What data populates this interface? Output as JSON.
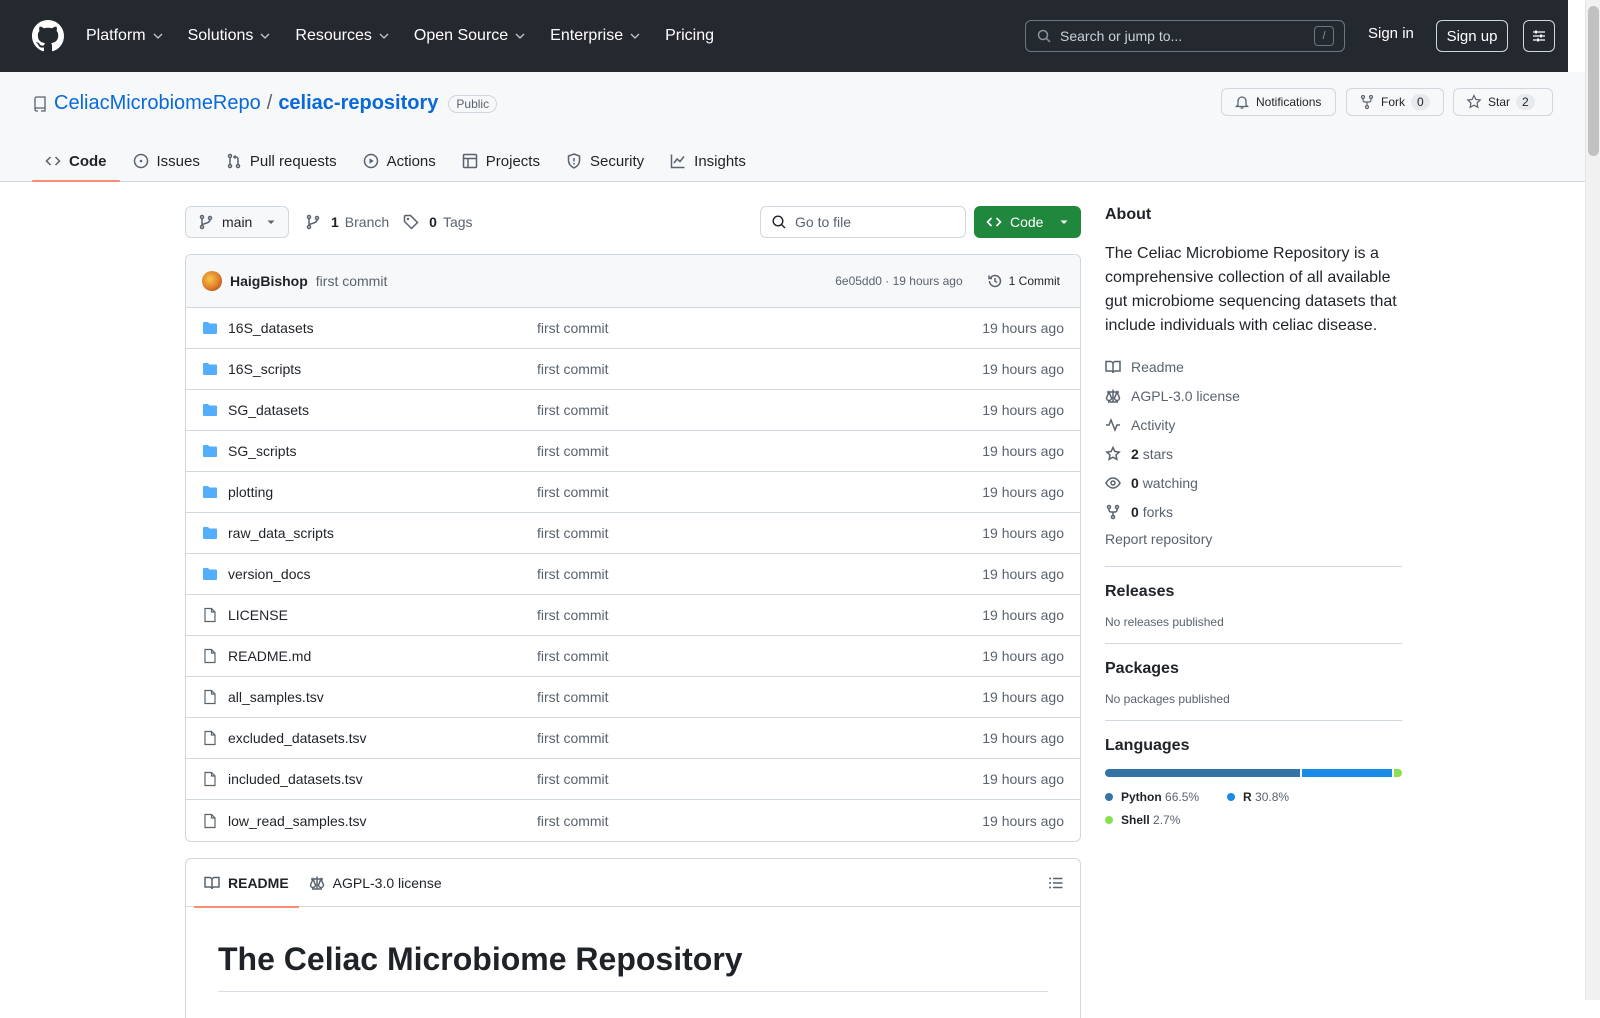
{
  "topbar": {
    "nav": [
      "Platform",
      "Solutions",
      "Resources",
      "Open Source",
      "Enterprise"
    ],
    "pricing": "Pricing",
    "search_placeholder": "Search or jump to...",
    "search_shortcut": "/",
    "sign_in": "Sign in",
    "sign_up": "Sign up"
  },
  "repo": {
    "owner": "CeliacMicrobiomeRepo",
    "separator": "/",
    "name": "celiac-repository",
    "visibility": "Public",
    "notifications": "Notifications",
    "fork_label": "Fork",
    "fork_count": "0",
    "star_label": "Star",
    "star_count": "2"
  },
  "tabs": [
    {
      "label": "Code",
      "icon": "code-icon"
    },
    {
      "label": "Issues",
      "icon": "issue-icon"
    },
    {
      "label": "Pull requests",
      "icon": "pull-request-icon"
    },
    {
      "label": "Actions",
      "icon": "play-icon"
    },
    {
      "label": "Projects",
      "icon": "table-icon"
    },
    {
      "label": "Security",
      "icon": "shield-icon"
    },
    {
      "label": "Insights",
      "icon": "graph-icon"
    }
  ],
  "toolbar": {
    "branch": "main",
    "branch_count": "1",
    "branch_label": "Branch",
    "tag_count": "0",
    "tag_label": "Tags",
    "go_to_file": "Go to file",
    "code_button": "Code"
  },
  "commit": {
    "author": "HaigBishop",
    "message": "first commit",
    "sha_time": "6e05dd0 · 19 hours ago",
    "commit_count": "1 Commit"
  },
  "files": [
    {
      "name": "16S_datasets",
      "type": "dir",
      "msg": "first commit",
      "age": "19 hours ago"
    },
    {
      "name": "16S_scripts",
      "type": "dir",
      "msg": "first commit",
      "age": "19 hours ago"
    },
    {
      "name": "SG_datasets",
      "type": "dir",
      "msg": "first commit",
      "age": "19 hours ago"
    },
    {
      "name": "SG_scripts",
      "type": "dir",
      "msg": "first commit",
      "age": "19 hours ago"
    },
    {
      "name": "plotting",
      "type": "dir",
      "msg": "first commit",
      "age": "19 hours ago"
    },
    {
      "name": "raw_data_scripts",
      "type": "dir",
      "msg": "first commit",
      "age": "19 hours ago"
    },
    {
      "name": "version_docs",
      "type": "dir",
      "msg": "first commit",
      "age": "19 hours ago"
    },
    {
      "name": "LICENSE",
      "type": "file",
      "msg": "first commit",
      "age": "19 hours ago"
    },
    {
      "name": "README.md",
      "type": "file",
      "msg": "first commit",
      "age": "19 hours ago"
    },
    {
      "name": "all_samples.tsv",
      "type": "file",
      "msg": "first commit",
      "age": "19 hours ago"
    },
    {
      "name": "excluded_datasets.tsv",
      "type": "file",
      "msg": "first commit",
      "age": "19 hours ago"
    },
    {
      "name": "included_datasets.tsv",
      "type": "file",
      "msg": "first commit",
      "age": "19 hours ago"
    },
    {
      "name": "low_read_samples.tsv",
      "type": "file",
      "msg": "first commit",
      "age": "19 hours ago"
    }
  ],
  "readme": {
    "tab_readme": "README",
    "tab_license": "AGPL-3.0 license",
    "heading": "The Celiac Microbiome Repository"
  },
  "about": {
    "title": "About",
    "description": "The Celiac Microbiome Repository is a comprehensive collection of all available gut microbiome sequencing datasets that include individuals with celiac disease.",
    "readme": "Readme",
    "license": "AGPL-3.0 license",
    "activity": "Activity",
    "stars_count": "2",
    "stars_label": "stars",
    "watching_count": "0",
    "watching_label": "watching",
    "forks_count": "0",
    "forks_label": "forks",
    "report": "Report repository"
  },
  "releases": {
    "title": "Releases",
    "empty": "No releases published"
  },
  "packages": {
    "title": "Packages",
    "empty": "No packages published"
  },
  "languages": {
    "title": "Languages",
    "items": [
      {
        "name": "Python",
        "pct": "66.5%",
        "value": 66.5,
        "color": "#3572A5"
      },
      {
        "name": "R",
        "pct": "30.8%",
        "value": 30.8,
        "color": "#198CE7"
      },
      {
        "name": "Shell",
        "pct": "2.7%",
        "value": 2.7,
        "color": "#89e051"
      }
    ]
  }
}
